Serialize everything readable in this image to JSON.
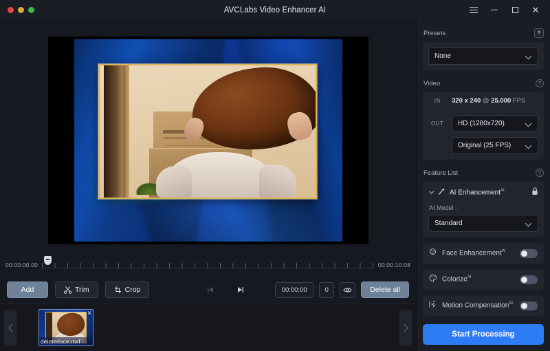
{
  "window": {
    "title": "AVCLabs Video Enhancer AI",
    "controls": {
      "menu": "menu-icon",
      "minimize": "minimize-icon",
      "maximize": "maximize-icon",
      "close": "close-icon"
    }
  },
  "timeline": {
    "start_time": "00:00:00.00",
    "end_time": "00:00:10.08"
  },
  "toolbar": {
    "add_label": "Add",
    "trim_label": "Trim",
    "crop_label": "Crop",
    "prev_frame": "previous-frame-icon",
    "next_frame": "next-frame-icon",
    "time_value": "00:00:00",
    "frame_value": "0",
    "preview_icon": "eye-icon",
    "delete_all_label": "Delete all"
  },
  "filmstrip": {
    "prev_arrow": "chevron-left-icon",
    "next_arrow": "chevron-right-icon",
    "items": [
      {
        "filename": "deinterlace.mxf",
        "close": "×"
      }
    ]
  },
  "panel": {
    "presets": {
      "title": "Presets",
      "add_label": "+",
      "selected": "None"
    },
    "video": {
      "title": "Video",
      "help": "?",
      "in_label": "IN",
      "in_resolution": "320 x 240",
      "in_at": "@",
      "in_fps": "25.000",
      "in_fps_unit": "FPS",
      "out_label": "OUT",
      "out_resolution": "HD (1280x720)",
      "out_framerate": "Original (25 FPS)"
    },
    "feature_list": {
      "title": "Feature List",
      "help": "?",
      "ai_enhancement": {
        "label": "AI Enhancement",
        "superscript": "AI",
        "locked": true,
        "model_label": "AI Model :",
        "model_value": "Standard"
      },
      "toggles": [
        {
          "label": "Face Enhancement",
          "superscript": "AI",
          "state": "off",
          "icon": "face-icon"
        },
        {
          "label": "Colorize",
          "superscript": "AI",
          "state": "off",
          "icon": "palette-icon"
        },
        {
          "label": "Motion Compensation",
          "superscript": "AI",
          "state": "off",
          "icon": "motion-icon"
        }
      ]
    },
    "start_button": "Start Processing"
  },
  "colors": {
    "accent": "#2e7bf6",
    "panel_bg": "#1b1d25",
    "card_bg": "#22252e",
    "app_bg": "#171920"
  }
}
